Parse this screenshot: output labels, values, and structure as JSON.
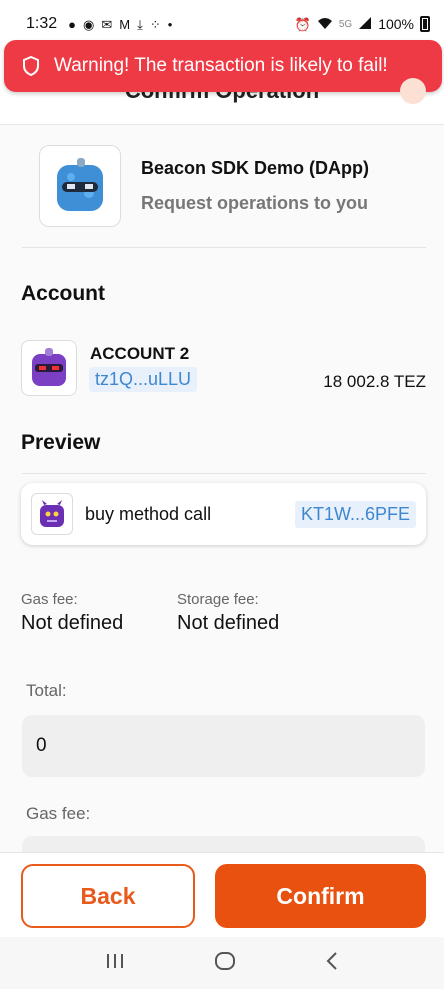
{
  "status_bar": {
    "time": "1:32",
    "network": "5G",
    "battery": "100%"
  },
  "warning": {
    "text": "Warning! The transaction is likely to fail!"
  },
  "header": {
    "title": "Confirm Operation"
  },
  "dapp": {
    "name": "Beacon SDK Demo (DApp)",
    "subtitle": "Request operations to you"
  },
  "account_section": {
    "title": "Account",
    "name": "ACCOUNT 2",
    "address": "tz1Q...uLLU",
    "balance": "18 002.8 TEZ"
  },
  "preview_section": {
    "title": "Preview",
    "operation_label": "buy method call",
    "contract_address": "KT1W...6PFE"
  },
  "fees": {
    "gas_fee_label": "Gas fee:",
    "gas_fee_value": "Not defined",
    "storage_fee_label": "Storage fee:",
    "storage_fee_value": "Not defined"
  },
  "form": {
    "total_label": "Total:",
    "total_value": "0",
    "gas_fee_label": "Gas fee:"
  },
  "actions": {
    "back_label": "Back",
    "confirm_label": "Confirm"
  },
  "colors": {
    "accent": "#e8510f",
    "warning": "#ee3a44",
    "address_bg": "#e8f1fb",
    "address_text": "#3d87cf"
  }
}
